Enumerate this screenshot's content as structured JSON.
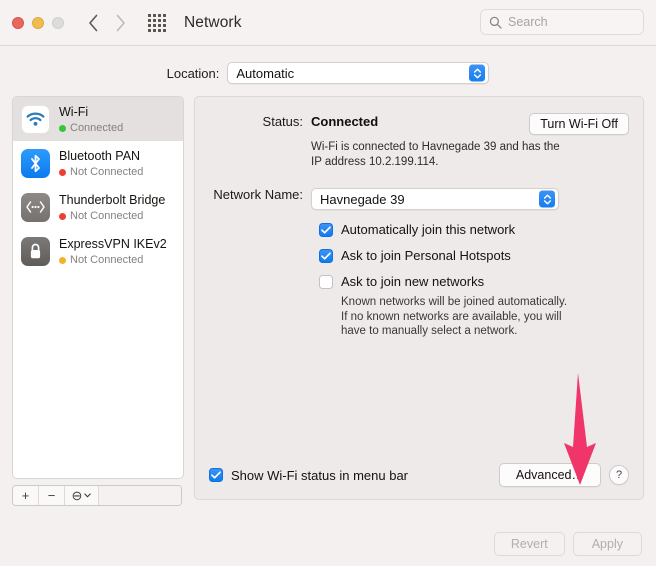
{
  "window": {
    "title": "Network",
    "traffic_lights": [
      "close-red",
      "minimize-yellow",
      "zoom-gray"
    ],
    "search_placeholder": "Search"
  },
  "location": {
    "label": "Location:",
    "value": "Automatic"
  },
  "sidebar": {
    "items": [
      {
        "name": "Wi-Fi",
        "status": "Connected",
        "status_color": "#35c63d",
        "icon": "wifi-icon",
        "selected": true
      },
      {
        "name": "Bluetooth PAN",
        "status": "Not Connected",
        "status_color": "#eb4034",
        "icon": "bluetooth-icon",
        "selected": false
      },
      {
        "name": "Thunderbolt Bridge",
        "status": "Not Connected",
        "status_color": "#eb4034",
        "icon": "thunderbolt-icon",
        "selected": false
      },
      {
        "name": "ExpressVPN IKEv2",
        "status": "Not Connected",
        "status_color": "#f0b429",
        "icon": "lock-icon",
        "selected": false
      }
    ],
    "toolbar": {
      "add": "+",
      "remove": "−",
      "action": "⊖"
    }
  },
  "main": {
    "status_label": "Status:",
    "status_value": "Connected",
    "toggle_button": "Turn Wi-Fi Off",
    "description": "Wi-Fi is connected to Havnegade 39 and has the IP address 10.2.199.114.",
    "network_name_label": "Network Name:",
    "network_name_value": "Havnegade 39",
    "checkboxes": [
      {
        "label": "Automatically join this network",
        "checked": true
      },
      {
        "label": "Ask to join Personal Hotspots",
        "checked": true
      },
      {
        "label": "Ask to join new networks",
        "checked": false
      }
    ],
    "hint": "Known networks will be joined automatically. If no known networks are available, you will have to manually select a network.",
    "menubar_checkbox": {
      "label": "Show Wi-Fi status in menu bar",
      "checked": true
    },
    "advanced_button": "Advanced…",
    "help_button": "?"
  },
  "footer": {
    "revert": "Revert",
    "apply": "Apply",
    "revert_enabled": false,
    "apply_enabled": false
  },
  "annotation": {
    "arrow_color": "#f0356b",
    "points_at": "advanced-button"
  }
}
